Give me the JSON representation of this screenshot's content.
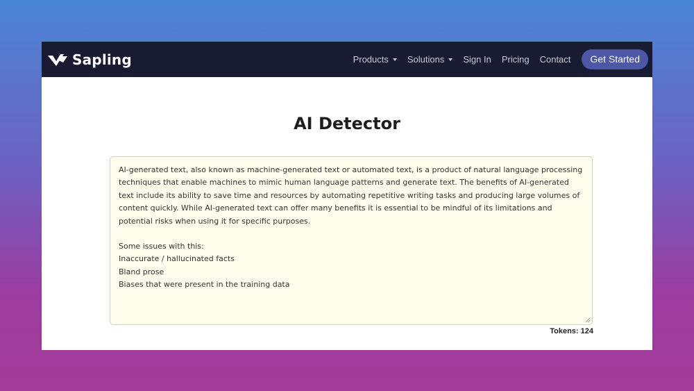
{
  "brand": {
    "name": "Sapling"
  },
  "nav": {
    "items": [
      {
        "label": "Products",
        "dropdown": true
      },
      {
        "label": "Solutions",
        "dropdown": true
      },
      {
        "label": "Sign In",
        "dropdown": false
      },
      {
        "label": "Pricing",
        "dropdown": false
      },
      {
        "label": "Contact",
        "dropdown": false
      }
    ],
    "cta_label": "Get Started"
  },
  "page": {
    "title": "AI Detector"
  },
  "editor": {
    "paragraph": "AI-generated text, also known as machine-generated text or automated text, is a product of natural language processing techniques that enable machines to mimic human language patterns and generate text. The benefits of AI-generated text include its ability to save time and resources by automating repetitive writing tasks and producing large volumes of content quickly. While AI-generated text can offer many benefits it is essential to be mindful of its limitations and potential risks when using it for specific purposes.",
    "lines": [
      "Some issues with this:",
      "Inaccurate / hallucinated facts",
      "Bland prose",
      "Biases that were present in the training data"
    ]
  },
  "tokens": {
    "label": "Tokens: 124"
  },
  "colors": {
    "navbar": "#191b33",
    "cta": "#4e57a7",
    "editor_bg": "#fdfeeb"
  }
}
